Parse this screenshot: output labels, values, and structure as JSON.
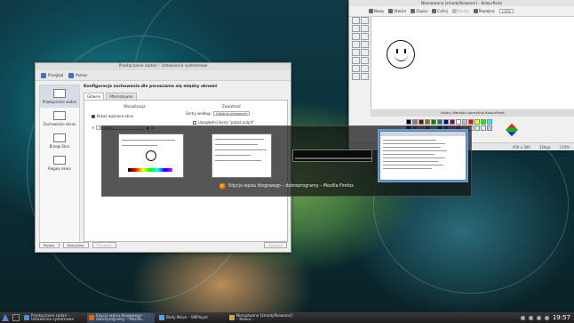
{
  "settings_window": {
    "title": "Przełączanie zadań – Ustawienia systemowe",
    "toolbar": {
      "back_label": "Przegląd",
      "help_label": "Pomoc"
    },
    "sidebar": [
      {
        "label": "Przełączanie zadań"
      },
      {
        "label": "Zachowanie ekran"
      },
      {
        "label": "Brzegi Ekra"
      },
      {
        "label": "Reguły okien"
      }
    ],
    "header": "Konfiguracja zachowania dla poruszania się między oknami",
    "tabs": [
      "Główne",
      "Alternatywna"
    ],
    "group_visual": "Wizualizacja",
    "group_content": "Zawartość",
    "show_selected_label": "Pokaż wybrane okno",
    "visual_select": "Miniatury",
    "sort_label": "Sortuj według:",
    "sort_value": "Ostatnio używanych",
    "include_desktop_label": "Uwzględnij ikonę \"pokaż pulpit\"",
    "buttons": {
      "help": "Pomoc",
      "defaults": "Domyślne",
      "reset": "Przywróć",
      "apply": "Zastosuj"
    }
  },
  "paint_window": {
    "title": "Nienazwane [zmodyfikowane] – KolourPaint",
    "toolbar": [
      "Nowy",
      "Otwórz",
      "Zapisz",
      "Cofnij",
      "Ponów",
      "Powiększ",
      "110%"
    ],
    "color_box_title": "Kolory Wartości domyślne KolourPaint",
    "status_size": "450 x 300",
    "status_depth": "32bpp",
    "status_zoom": "110%",
    "palette": [
      "#000000",
      "#808080",
      "#800000",
      "#808000",
      "#008000",
      "#008080",
      "#000080",
      "#800080",
      "#ffffff",
      "#c0c0c0",
      "#ff0000",
      "#ffff00",
      "#00ff00",
      "#00ffff",
      "#0000ff",
      "#ff00ff",
      "#ff8040",
      "#804000",
      "#80ff80",
      "#004040",
      "#0080ff",
      "#8080ff",
      "#ff0080",
      "#ffc0c0",
      "#ffffc0",
      "#c0ffc0",
      "#c0ffff",
      "#c0c0ff"
    ]
  },
  "switcher": {
    "selected_title": "Edycja wpisu blogowego – dobreprogramy – Mozilla Firefox"
  },
  "taskbar": {
    "tasks": [
      {
        "label": "Przełączanie zadań – Ustawienia systemowe",
        "color": "#4a8be0"
      },
      {
        "label": "Edycja wpisu blogowego – dobreprogramy – Mozilla...",
        "color": "#e66000"
      },
      {
        "label": "Body Move – SMPlayer",
        "color": "#5ca0d8"
      },
      {
        "label": "Nienazwane [zmodyfikowane] – Kolour...",
        "color": "#d8a040"
      }
    ],
    "clock": "19:57"
  }
}
